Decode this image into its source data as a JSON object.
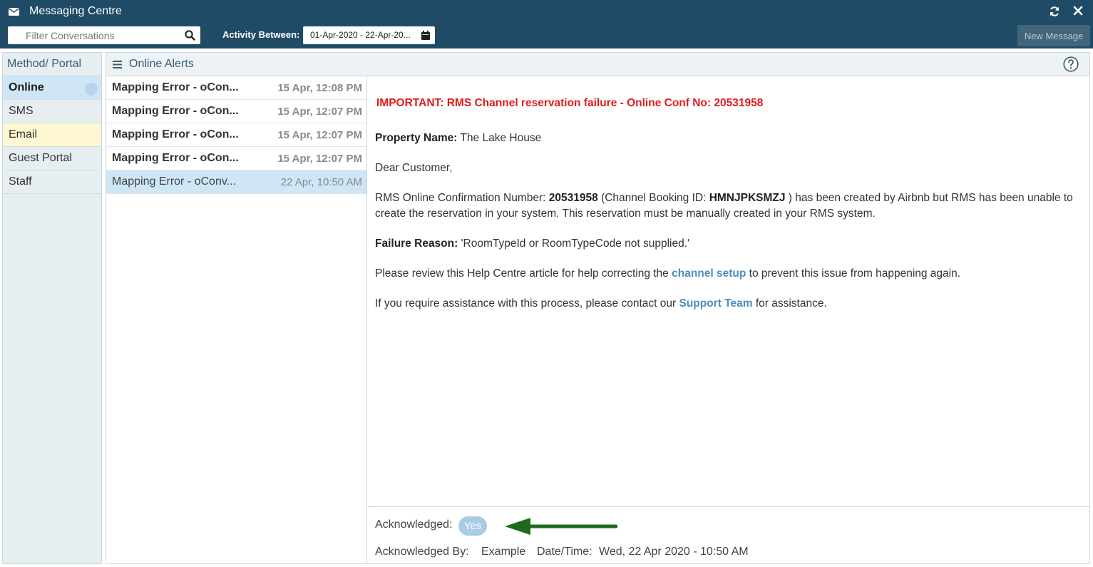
{
  "window": {
    "title": "Messaging Centre",
    "icons": [
      "envelope-icon",
      "refresh-icon",
      "close-icon"
    ]
  },
  "toolbar": {
    "filter_placeholder": "Filter Conversations",
    "activity_label": "Activity Between:",
    "date_range": "01-Apr-2020 - 22-Apr-20...",
    "new_message_label": "New Message"
  },
  "methods": {
    "header": "Method/ Portal",
    "items": [
      {
        "label": "Online"
      },
      {
        "label": "SMS"
      },
      {
        "label": "Email"
      },
      {
        "label": "Guest Portal"
      },
      {
        "label": "Staff"
      }
    ],
    "selected": "Online"
  },
  "main": {
    "header_title": "Online Alerts"
  },
  "conversations": [
    {
      "subject": "Mapping Error - oCon...",
      "time": "15 Apr, 12:08 PM"
    },
    {
      "subject": "Mapping Error - oCon...",
      "time": "15 Apr, 12:07 PM"
    },
    {
      "subject": "Mapping Error - oCon...",
      "time": "15 Apr, 12:07 PM"
    },
    {
      "subject": "Mapping Error - oCon...",
      "time": "15 Apr, 12:07 PM"
    },
    {
      "subject": "Mapping Error - oConv...",
      "time": "22 Apr, 10:50 AM"
    }
  ],
  "message": {
    "important": "IMPORTANT: RMS Channel reservation failure - Online Conf No: 20531958",
    "property_label": "Property Name:",
    "property_value": "The Lake House",
    "greeting": "Dear Customer,",
    "p1_a": "RMS Online Confirmation Number: ",
    "p1_conf": "20531958",
    "p1_b": " (Channel Booking ID: ",
    "p1_booking": "HMNJPKSMZJ",
    "p1_c": " ) has been created by Airbnb but RMS has been unable to create the reservation in your system. This reservation must be manually created in your RMS system.",
    "failure_label": "Failure Reason:",
    "failure_value": "'RoomTypeId or RoomTypeCode not supplied.'",
    "p3_a": "Please review this Help Centre article for help correcting the ",
    "p3_link": "channel setup",
    "p3_b": " to prevent this issue from happening again.",
    "p4_a": "If you require assistance with this process, please contact our ",
    "p4_link": "Support Team",
    "p4_b": " for assistance."
  },
  "acknowledgement": {
    "label": "Acknowledged:",
    "toggle_value": "Yes",
    "by_label": "Acknowledged By:",
    "by_value": "Example",
    "datetime_label": "Date/Time:",
    "datetime_value": "Wed, 22 Apr 2020 - 10:50 AM"
  },
  "colors": {
    "header_bg": "#1f4b66",
    "selected_bg": "#cfe6f7",
    "email_bg": "#fdf7d2",
    "important_text": "#e01c1c",
    "link": "#4a8fbd",
    "arrow": "#1e6b1e"
  }
}
